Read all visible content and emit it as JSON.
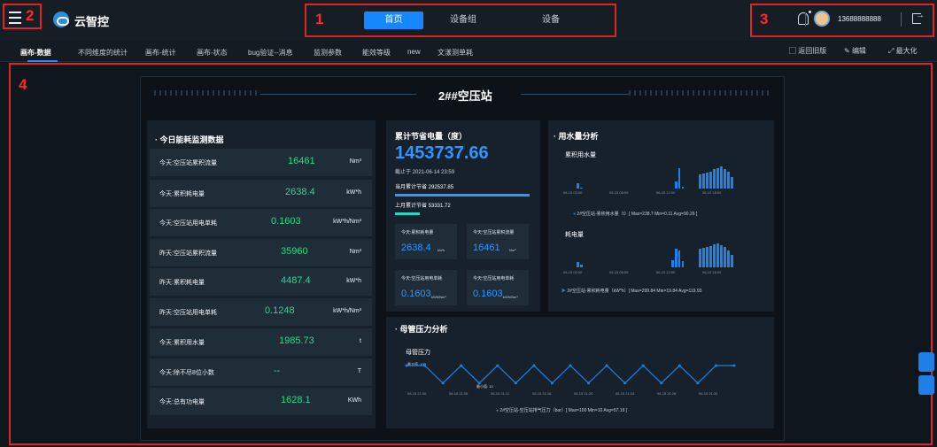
{
  "app": {
    "name": "云智控"
  },
  "annotations": [
    "1",
    "2",
    "3",
    "4"
  ],
  "top_tabs": [
    "首页",
    "设备组",
    "设备"
  ],
  "user": {
    "phone": "13688888888"
  },
  "nav2": [
    "画布-数据",
    "不同维度的统计",
    "画布-统计",
    "画布-状态",
    "bug验证--消息",
    "监测参数",
    "能效等级",
    "new",
    "文漾测单耗"
  ],
  "right_tools": [
    "返回旧版",
    "编辑",
    "最大化"
  ],
  "dashboard": {
    "title": "2##空压站",
    "today_title": "今日能耗监测数据",
    "rows": [
      {
        "label": "今天:空压站累积流量",
        "value": "16461",
        "unit": "Nm³"
      },
      {
        "label": "今天:累积耗电量",
        "value": "2638.4",
        "unit": "kW*h"
      },
      {
        "label": "今天:空压站用电单耗",
        "value": "0.1603",
        "unit": "kW*h/Nm³"
      },
      {
        "label": "昨天:空压站累积流量",
        "value": "35960",
        "unit": "Nm³"
      },
      {
        "label": "昨天:累积耗电量",
        "value": "4487.4",
        "unit": "kW*h"
      },
      {
        "label": "昨天:空压站用电单耗",
        "value": "0.1248",
        "unit": "kW*h/Nm³"
      },
      {
        "label": "今天:累积用水量",
        "value": "1985.73",
        "unit": "t"
      },
      {
        "label": "今天:除不尽8位小数",
        "value": "--",
        "unit": "T"
      },
      {
        "label": "今天:总有功电量",
        "value": "1628.1",
        "unit": "KWh"
      }
    ],
    "saving": {
      "title": "累计节省电量（度）",
      "value": "1453737.66",
      "date": "截止于 2021-06-14 23:59",
      "month": "当月累计节省 292537.85",
      "last_month": "上月累计节省 53331.72"
    },
    "cards": [
      {
        "title": "今天:累积耗电量",
        "value": "2638.4",
        "unit": "kWh"
      },
      {
        "title": "今天:空压站累积流量",
        "value": "16461",
        "unit": "Nm³"
      },
      {
        "title": "今天:空压站用电单耗",
        "value": "0.1603",
        "unit": "kWh/Nm³"
      },
      {
        "title": "今天:空压站用电单耗",
        "value": "0.1603",
        "unit": "kWh/Nm³"
      }
    ],
    "water": {
      "title": "用水量分析",
      "sub1": "累积用水量",
      "legend1": "2#空压站-累积用水量（t）[ Max=238.7 Min=0.11 Avg=90.26 ]",
      "sub2": "耗电量",
      "legend2": "2#空压站-累积耗电量（kW*h）[ Max=299.84 Min=19.84 Avg=119.93",
      "ticks": [
        "06-15 00:00",
        "06-15 06:00",
        "06-15 12:00",
        "06-15 18:00"
      ]
    },
    "pressure": {
      "title": "母管压力分析",
      "sub": "母管压力",
      "max_label": "最大值: 100",
      "min_label": "最小值: 10",
      "legend": "2#空压站-空压站排气压力（bar）[ Max=100 Min=10 Avg=57.19 ]",
      "ticks": [
        "06-15 21:00",
        "06-15 21:08",
        "06-15 21:12",
        "06-15 21:16",
        "06-15 21:20",
        "06-15 21:24",
        "06-15 21:28",
        "06-15 21:32"
      ]
    }
  },
  "chart_data": [
    {
      "type": "bar",
      "title": "累积用水量",
      "values": [
        60,
        12,
        0,
        0,
        0,
        0,
        0,
        0,
        0,
        0,
        0,
        0,
        0,
        0,
        0,
        0,
        0,
        0,
        0,
        0,
        0,
        0,
        0,
        0,
        0,
        0,
        0,
        0,
        70,
        210,
        20,
        0,
        0,
        0,
        0,
        150,
        160,
        170,
        180,
        200,
        210,
        230,
        200,
        180,
        120
      ]
    },
    {
      "type": "bar",
      "title": "耗电量",
      "values": [
        60,
        30,
        0,
        0,
        0,
        0,
        0,
        0,
        0,
        0,
        0,
        0,
        0,
        0,
        0,
        0,
        0,
        0,
        0,
        0,
        0,
        0,
        0,
        0,
        0,
        0,
        0,
        90,
        230,
        200,
        70,
        0,
        0,
        0,
        0,
        220,
        240,
        250,
        260,
        280,
        290,
        270,
        250,
        200,
        150
      ]
    },
    {
      "type": "line",
      "title": "母管压力",
      "values": [
        100,
        100,
        10,
        100,
        10,
        100,
        10,
        100,
        10,
        100,
        10,
        100,
        10,
        100,
        10,
        100,
        10,
        100,
        100
      ]
    }
  ]
}
